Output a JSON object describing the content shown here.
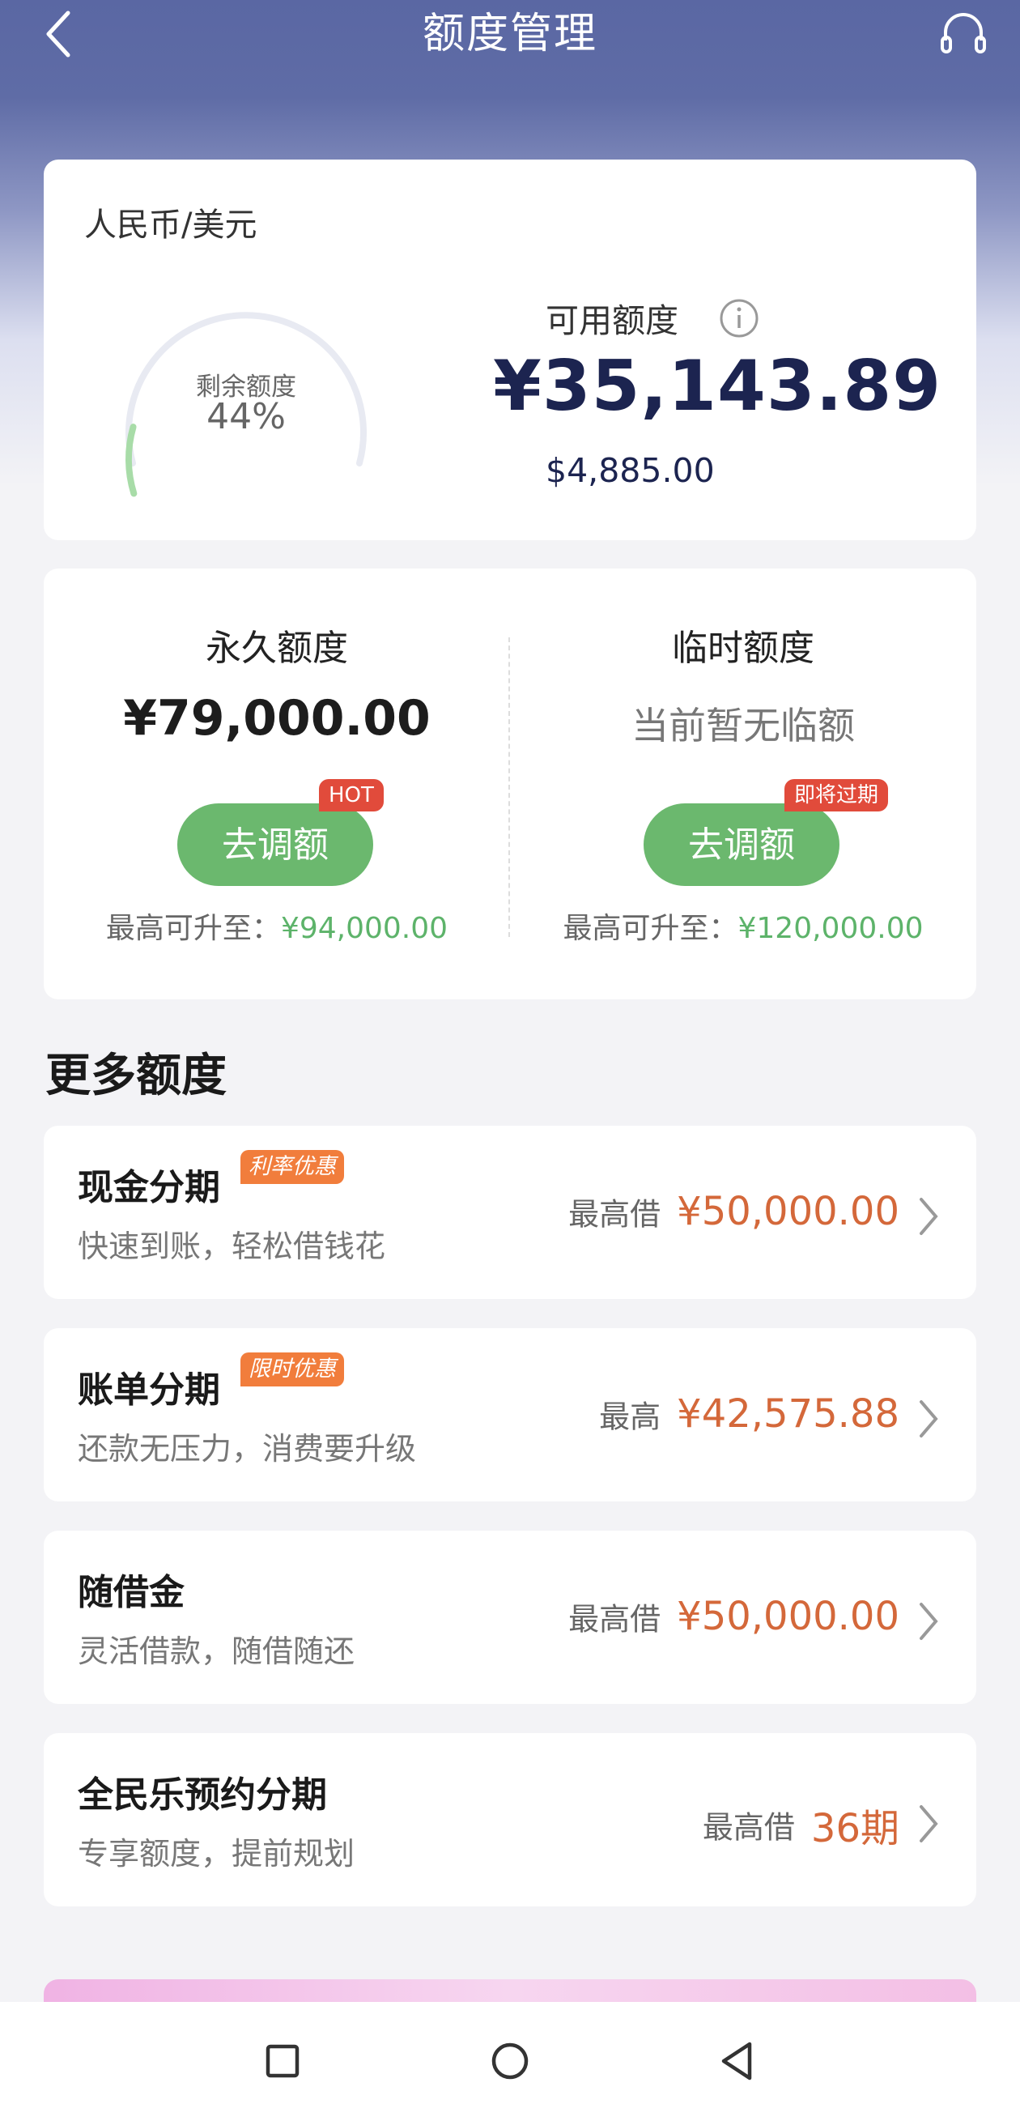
{
  "header": {
    "title": "额度管理",
    "back_icon": "chevron-left-icon",
    "support_icon": "headset-icon"
  },
  "summary": {
    "currency": "人民币/美元",
    "gauge_label": "剩余额度",
    "gauge_percent": "44%",
    "gauge_fraction": 0.44,
    "available_label": "可用额度",
    "available_cny": "¥35,143.89",
    "available_usd": "$4,885.00"
  },
  "quota": {
    "permanent": {
      "title": "永久额度",
      "value": "¥79,000.00",
      "button": "去调额",
      "tag": "HOT",
      "max_prefix": "最高可升至：",
      "max_value": "¥94,000.00"
    },
    "temporary": {
      "title": "临时额度",
      "value": "当前暂无临额",
      "button": "去调额",
      "tag": "即将过期",
      "max_prefix": "最高可升至：",
      "max_value": "¥120,000.00"
    }
  },
  "more": {
    "title": "更多额度",
    "items": [
      {
        "name": "现金分期",
        "tag": "利率优惠",
        "desc": "快速到账，轻松借钱花",
        "prefix": "最高借",
        "amount": "¥50,000.00"
      },
      {
        "name": "账单分期",
        "tag": "限时优惠",
        "desc": "还款无压力，消费要升级",
        "prefix": "最高",
        "amount": "¥42,575.88"
      },
      {
        "name": "随借金",
        "tag": "",
        "desc": "灵活借款，随借随还",
        "prefix": "最高借",
        "amount": "¥50,000.00"
      },
      {
        "name": "全民乐预约分期",
        "tag": "",
        "desc": "专享额度，提前规划",
        "prefix": "最高借",
        "amount": "36期"
      }
    ]
  },
  "colors": {
    "header": "#5a67a3",
    "button_green": "#6bb86e",
    "amount_orange": "#d4683a",
    "tag_red": "#e14b3b"
  }
}
